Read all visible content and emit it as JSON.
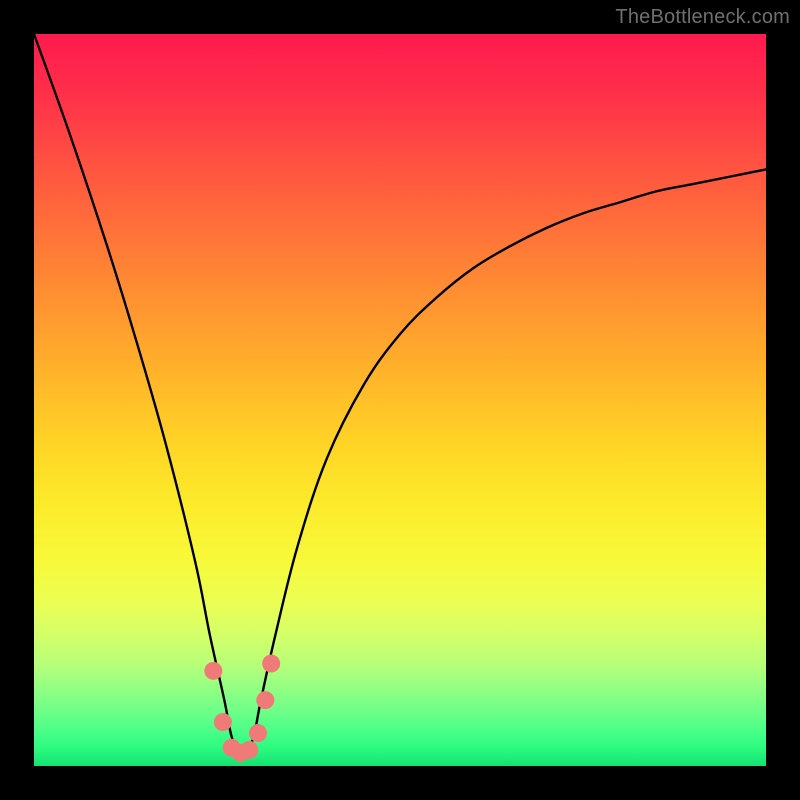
{
  "attribution": "TheBottleneck.com",
  "colors": {
    "frame": "#000000",
    "curve_stroke": "#000000",
    "dot_fill": "#f07a78",
    "gradient_top": "#ff1a4f",
    "gradient_bottom": "#17e173"
  },
  "chart_data": {
    "type": "line",
    "title": "",
    "xlabel": "",
    "ylabel": "",
    "xlim": [
      0,
      100
    ],
    "ylim": [
      0,
      100
    ],
    "grid": false,
    "legend": false,
    "note": "Axes unlabeled in source image. x interpreted as position across plot (0=left,100=right); y as bottleneck % (0=bottom/good,100=top/bad). Values estimated from curve geometry.",
    "x": [
      0,
      5,
      10,
      14,
      18,
      22,
      24,
      26,
      27,
      28,
      29,
      30,
      31,
      33,
      36,
      40,
      45,
      50,
      55,
      60,
      65,
      70,
      75,
      80,
      85,
      90,
      95,
      100
    ],
    "values": [
      100,
      86,
      71,
      58,
      44,
      28,
      18,
      9,
      4,
      2,
      2,
      4,
      9,
      18,
      30,
      42,
      52,
      59,
      64,
      68,
      71,
      73.5,
      75.5,
      77,
      78.5,
      79.5,
      80.5,
      81.5
    ],
    "highlight_dots_x": [
      24.5,
      25.8,
      27.0,
      28.2,
      29.4,
      30.6,
      31.6,
      32.4
    ],
    "highlight_dots_y": [
      13,
      6,
      2.5,
      1.8,
      2.2,
      4.5,
      9,
      14
    ]
  }
}
